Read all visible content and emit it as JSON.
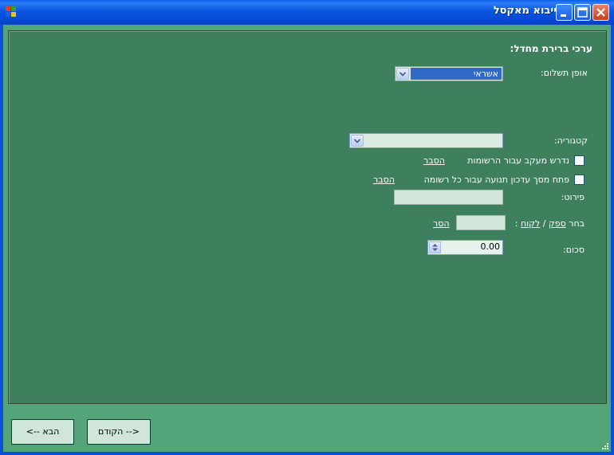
{
  "window": {
    "title": "ייבוא מאקסל"
  },
  "section": {
    "heading": "ערכי ברירת מחדל:"
  },
  "payment": {
    "label": "אופן תשלום:",
    "selected": "אשראי"
  },
  "category": {
    "label": "קטגוריה:",
    "selected": ""
  },
  "tracking": {
    "label": "נדרש מעקב עבור הרשומות",
    "explain": "הסבר",
    "checked": false
  },
  "update_screen": {
    "label": "פתח מסך עדכון תנועה עבור כל רשומה",
    "explain": "הסבר",
    "checked": false
  },
  "details": {
    "label": "פירוט:",
    "value": ""
  },
  "choose": {
    "prefix": "בחר",
    "supplier": "ספק",
    "slash": "/",
    "customer": "לקוח",
    "colon": ":",
    "remove": "הסר",
    "value": ""
  },
  "amount": {
    "label": "סכום:",
    "value": "0.00"
  },
  "nav": {
    "next": "הבא -->",
    "prev": "<-- הקודם"
  },
  "colors": {
    "panel": "#3e7f5e",
    "client": "#54a47a",
    "titlebar": "#0a55de"
  }
}
